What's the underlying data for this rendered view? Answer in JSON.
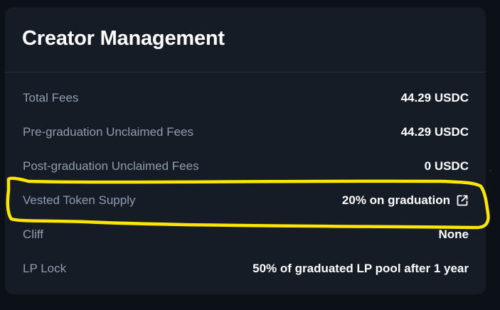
{
  "card": {
    "title": "Creator Management",
    "rows": [
      {
        "label": "Total Fees",
        "value": "44.29 USDC"
      },
      {
        "label": "Pre-graduation Unclaimed Fees",
        "value": "44.29 USDC"
      },
      {
        "label": "Post-graduation Unclaimed Fees",
        "value": "0 USDC"
      },
      {
        "label": "Vested Token Supply",
        "value": "20% on graduation",
        "icon": "external-link-icon"
      },
      {
        "label": "Cliff",
        "value": "None"
      },
      {
        "label": "LP Lock",
        "value": "50% of graduated LP pool after 1 year"
      }
    ]
  },
  "colors": {
    "background": "#0c1117",
    "card": "#161c25",
    "label": "#8f9db0",
    "value": "#ffffff",
    "annotation": "#ffe600"
  }
}
